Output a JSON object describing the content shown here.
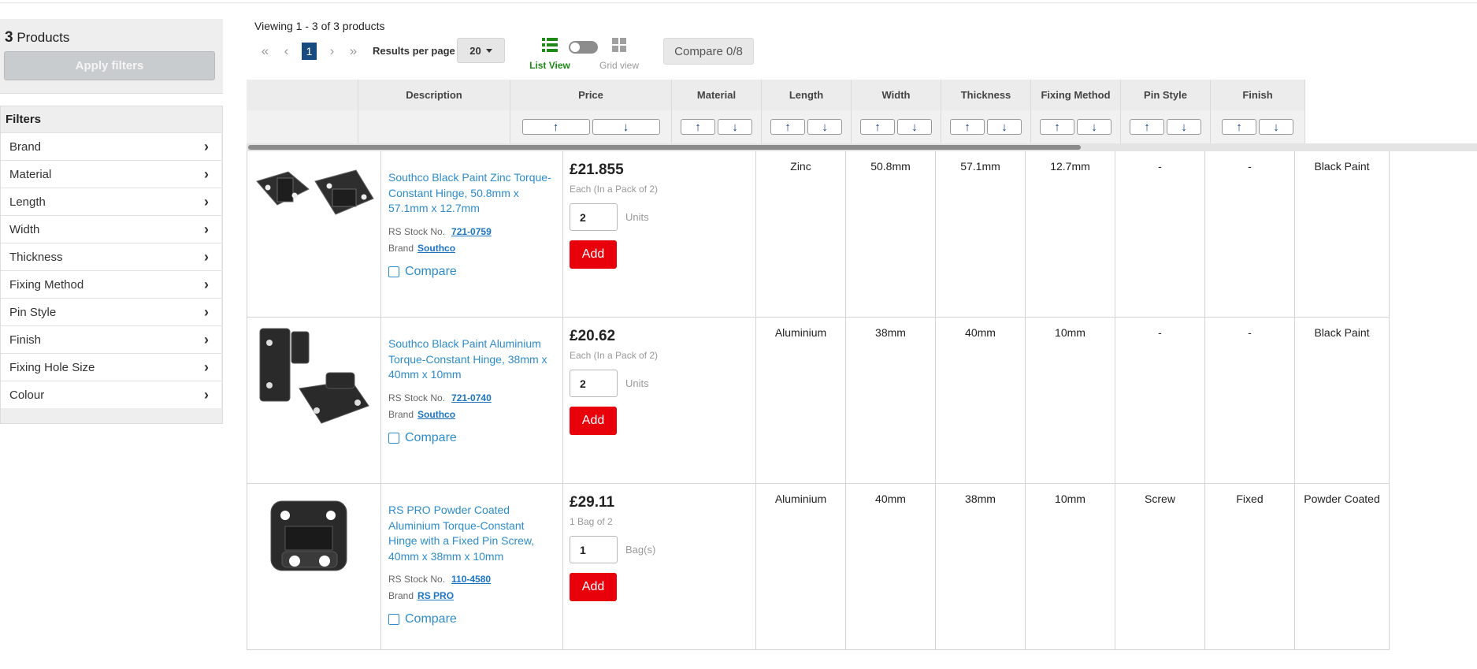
{
  "sidebar": {
    "count": "3",
    "count_label": "Products",
    "apply_label": "Apply filters",
    "filters_title": "Filters",
    "filters": [
      "Brand",
      "Material",
      "Length",
      "Width",
      "Thickness",
      "Fixing Method",
      "Pin Style",
      "Finish",
      "Fixing Hole Size",
      "Colour"
    ]
  },
  "toolbar": {
    "viewing": "Viewing 1 - 3 of 3 products",
    "page": "1",
    "results_label": "Results per page",
    "results_value": "20",
    "list_view": "List View",
    "grid_view": "Grid view",
    "compare": "Compare 0/8"
  },
  "table": {
    "headers": [
      "",
      "Description",
      "Price",
      "Material",
      "Length",
      "Width",
      "Thickness",
      "Fixing Method",
      "Pin Style",
      "Finish"
    ],
    "stock_label": "RS Stock No.",
    "brand_label": "Brand",
    "compare_label": "Compare",
    "add_label": "Add",
    "products": [
      {
        "name": "Southco Black Paint Zinc Torque-Constant Hinge, 50.8mm x 57.1mm x 12.7mm",
        "stock": "721-0759",
        "brand": "Southco",
        "price": "£21.855",
        "each": "Each (In a Pack of 2)",
        "qty": "2",
        "unit": "Units",
        "attrs": [
          "Zinc",
          "50.8mm",
          "57.1mm",
          "12.7mm",
          "-",
          "-",
          "Black Paint"
        ]
      },
      {
        "name": "Southco Black Paint Aluminium Torque-Constant Hinge, 38mm x 40mm x 10mm",
        "stock": "721-0740",
        "brand": "Southco",
        "price": "£20.62",
        "each": "Each (In a Pack of 2)",
        "qty": "2",
        "unit": "Units",
        "attrs": [
          "Aluminium",
          "38mm",
          "40mm",
          "10mm",
          "-",
          "-",
          "Black Paint"
        ]
      },
      {
        "name": "RS PRO Powder Coated Aluminium Torque-Constant Hinge with a Fixed Pin Screw, 40mm x 38mm x 10mm",
        "stock": "110-4580",
        "brand": "RS PRO",
        "price": "£29.11",
        "each": "1 Bag of 2",
        "qty": "1",
        "unit": "Bag(s)",
        "attrs": [
          "Aluminium",
          "40mm",
          "38mm",
          "10mm",
          "Screw",
          "Fixed",
          "Powder Coated"
        ]
      }
    ]
  },
  "colors": {
    "accent_blue": "#2d8ccc",
    "add_red": "#e8000b",
    "list_green": "#1f8a18",
    "page_blue": "#164a80"
  }
}
